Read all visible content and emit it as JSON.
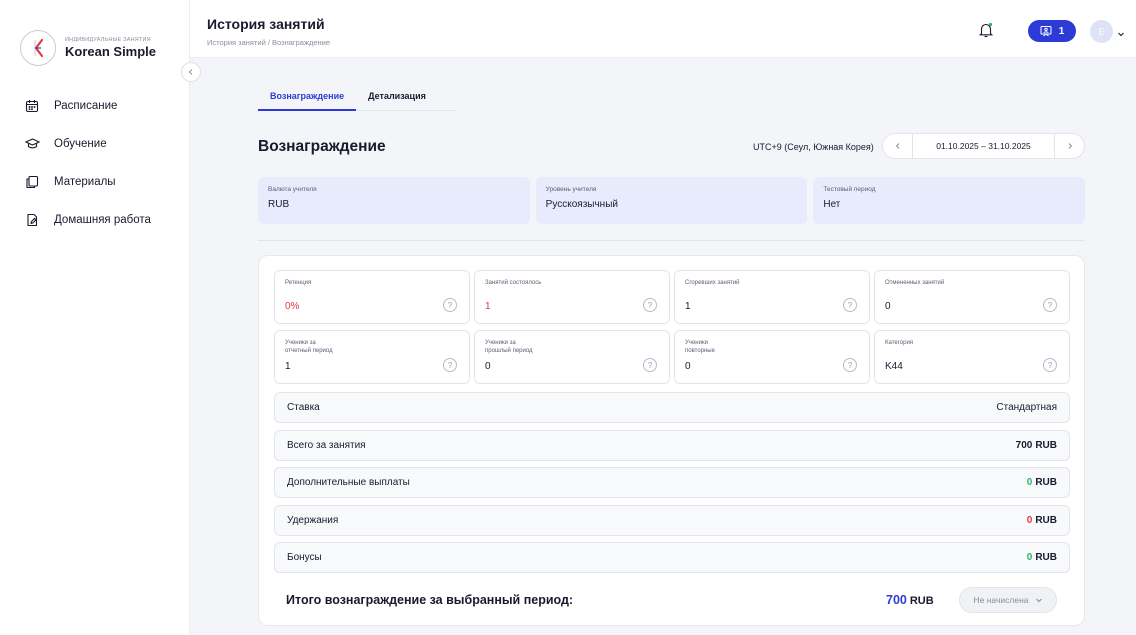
{
  "sidebar": {
    "brand_sub": "ИНДИВИДУАЛЬНЫЕ ЗАНЯТИЯ",
    "brand_name": "Korean Simple",
    "items": [
      {
        "label": "Расписание",
        "icon": "calendar-icon"
      },
      {
        "label": "Обучение",
        "icon": "graduation-cap-icon"
      },
      {
        "label": "Материалы",
        "icon": "copy-icon"
      },
      {
        "label": "Домашняя работа",
        "icon": "document-edit-icon"
      }
    ]
  },
  "header": {
    "title": "История занятий",
    "breadcrumb": "История занятий / Вознаграждение",
    "counter": "1",
    "avatar_letter": "E"
  },
  "tabs": [
    {
      "label": "Вознаграждение",
      "active": true
    },
    {
      "label": "Детализация",
      "active": false
    }
  ],
  "section": {
    "title": "Вознаграждение",
    "timezone": "UTC+9 (Сеул, Южная Корея)",
    "date_range": "01.10.2025 – 31.10.2025"
  },
  "info_cards": [
    {
      "label": "Валюта учителя",
      "value": "RUB"
    },
    {
      "label": "Уровень учителя",
      "value": "Русскоязычный"
    },
    {
      "label": "Тестовый период",
      "value": "Нет"
    }
  ],
  "stats": [
    {
      "label": "Ретенция",
      "value": "0%",
      "accent": "red"
    },
    {
      "label": "Занятий состоялось",
      "value": "1",
      "accent": "red"
    },
    {
      "label": "Сгоревших занятий",
      "value": "1",
      "accent": ""
    },
    {
      "label": "Отмененных занятий",
      "value": "0",
      "accent": ""
    },
    {
      "label": "Ученики за\nотчетный период",
      "value": "1",
      "accent": ""
    },
    {
      "label": "Ученики за\nпрошлый период",
      "value": "0",
      "accent": ""
    },
    {
      "label": "Ученики\nповторные",
      "value": "0",
      "accent": ""
    },
    {
      "label": "Категория",
      "value": "K44",
      "accent": ""
    }
  ],
  "help_glyph": "?",
  "rows": {
    "rate": {
      "label": "Ставка",
      "value": "Стандартная"
    },
    "total_lessons": {
      "label": "Всего за занятия",
      "amount": "700",
      "currency": "RUB"
    },
    "extra": {
      "label": "Дополнительные выплаты",
      "amount": "0",
      "currency": "RUB"
    },
    "deductions": {
      "label": "Удержания",
      "amount": "0",
      "currency": "RUB"
    },
    "bonuses": {
      "label": "Бонусы",
      "amount": "0",
      "currency": "RUB"
    }
  },
  "total": {
    "label": "Итого вознаграждение за выбранный период:",
    "amount": "700",
    "currency": "RUB",
    "status": "Не начислена"
  },
  "colors": {
    "accent": "#2d3bd6",
    "info_card_bg": "#e8ebfb",
    "red": "#e23a3a",
    "green": "#2fb36b"
  }
}
